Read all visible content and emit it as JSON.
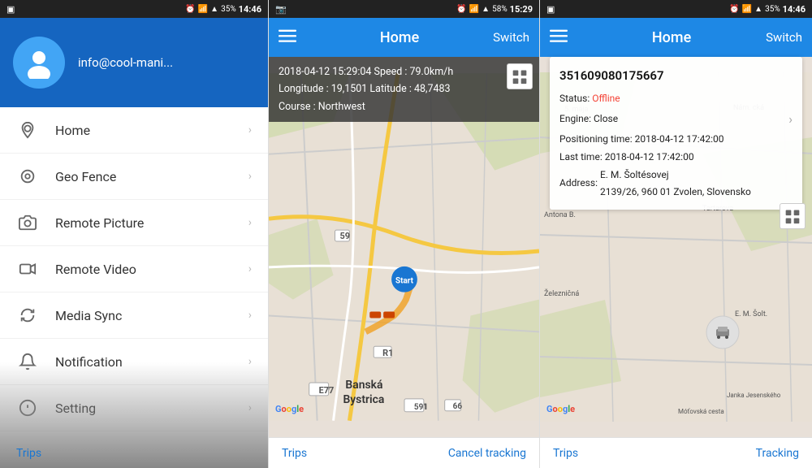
{
  "panel1": {
    "statusBar": {
      "left": "☰",
      "time": "14:46",
      "battery": "35%"
    },
    "profile": {
      "email": "info@cool-mani..."
    },
    "navItems": [
      {
        "id": "home",
        "label": "Home",
        "icon": "location"
      },
      {
        "id": "geo-fence",
        "label": "Geo Fence",
        "icon": "fence"
      },
      {
        "id": "remote-picture",
        "label": "Remote Picture",
        "icon": "camera"
      },
      {
        "id": "remote-video",
        "label": "Remote Video",
        "icon": "video"
      },
      {
        "id": "media-sync",
        "label": "Media Sync",
        "icon": "sync"
      },
      {
        "id": "notification",
        "label": "Notification",
        "icon": "bell"
      },
      {
        "id": "setting",
        "label": "Setting",
        "icon": "info"
      }
    ],
    "tripsLink": "Trips"
  },
  "panel2": {
    "statusBar": {
      "time": "15:29",
      "battery": "58%"
    },
    "header": {
      "title": "Home",
      "switchLabel": "Switch"
    },
    "infoOverlay": {
      "line1": "2018-04-12 15:29:04  Speed : 79.0km/h",
      "line2": "Longitude : 19,1501  Latitude : 48,7483",
      "line3": "Course : Northwest"
    },
    "googleWatermark": "Google",
    "footer": {
      "left": "Trips",
      "right": "Cancel tracking"
    }
  },
  "panel3": {
    "statusBar": {
      "time": "14:46",
      "battery": "35%"
    },
    "header": {
      "title": "Home",
      "switchLabel": "Switch"
    },
    "infoCard": {
      "deviceId": "351609080175667",
      "status": {
        "label": "Status:",
        "value": "Offline"
      },
      "engine": {
        "label": "Engine:",
        "value": "Close"
      },
      "positioningTime": {
        "label": "Positioning time:",
        "value": "2018-04-12 17:42:00"
      },
      "lastTime": {
        "label": "Last time:",
        "value": "2018-04-12 17:42:00"
      },
      "address": {
        "label": "Address:",
        "value": "E. M. Šoltésovej\n2139/26, 960 01 Zvolen, Slovensko"
      }
    },
    "googleWatermark": "Google",
    "footer": {
      "left": "Trips",
      "right": "Tracking"
    }
  }
}
